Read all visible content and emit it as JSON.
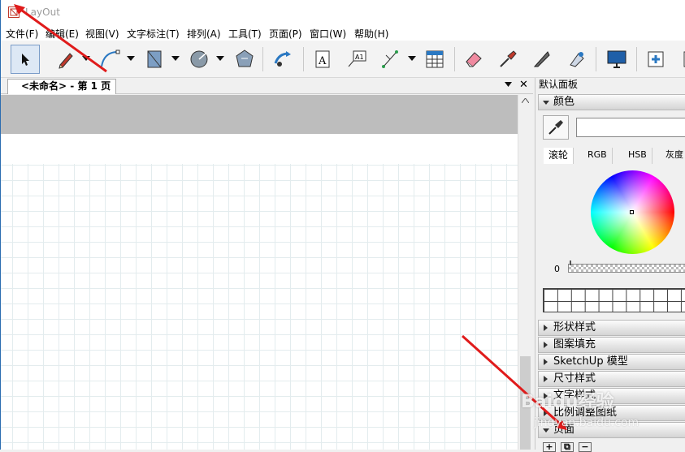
{
  "window": {
    "title": "LayOut"
  },
  "menu": [
    "文件(F)",
    "编辑(E)",
    "视图(V)",
    "文字标注(T)",
    "排列(A)",
    "工具(T)",
    "页面(P)",
    "窗口(W)",
    "帮助(H)"
  ],
  "document_tab": {
    "label": "<未命名> - 第 1 页",
    "close": "✕"
  },
  "panel": {
    "title": "默认面板",
    "color_section": "颜色",
    "color_tabs": [
      "滚轮",
      "RGB",
      "HSB",
      "灰度"
    ],
    "alpha_value": "0",
    "sections": [
      "形状样式",
      "图案填充",
      "SketchUp 模型",
      "尺寸样式",
      "文字样式",
      "比例调整图纸",
      "页面"
    ]
  },
  "page_buttons": [
    "+",
    "⧉",
    "−"
  ],
  "watermark": {
    "main": "Baidu经验",
    "sub": "jingyan.baidu.com"
  },
  "colors": {
    "accent_arrow": "#e01b1b",
    "window_border": "#2b6cb0"
  }
}
